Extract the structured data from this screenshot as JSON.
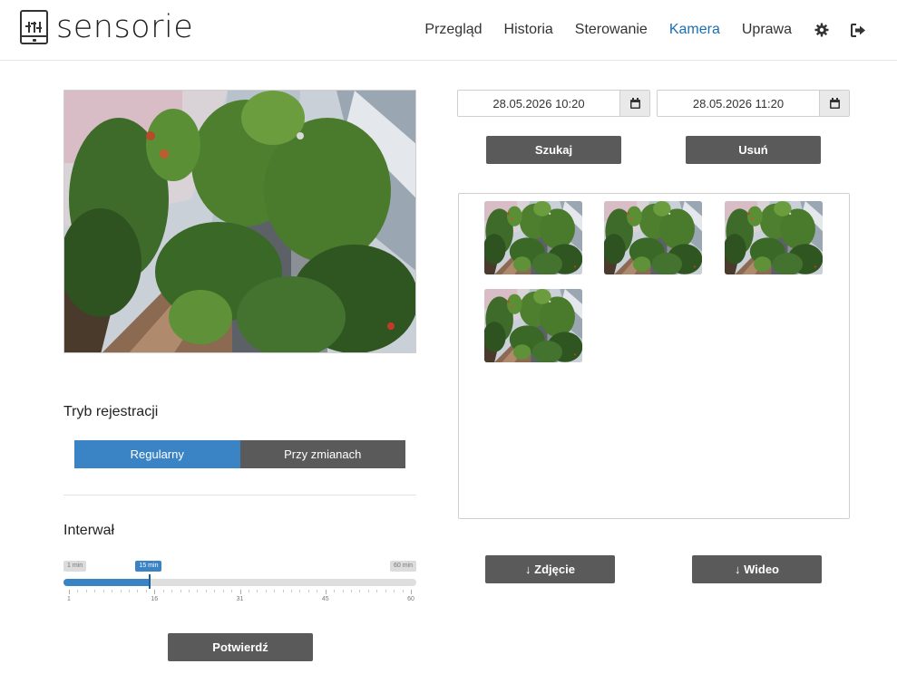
{
  "app": {
    "name": "sensorie"
  },
  "nav": {
    "items": [
      {
        "label": "Przegląd",
        "active": false
      },
      {
        "label": "Historia",
        "active": false
      },
      {
        "label": "Sterowanie",
        "active": false
      },
      {
        "label": "Kamera",
        "active": true
      },
      {
        "label": "Uprawa",
        "active": false
      }
    ],
    "settings_icon": "gear-icon",
    "logout_icon": "sign-out-icon",
    "active_color": "#1a6fb3"
  },
  "recording": {
    "title": "Tryb rejestracji",
    "options": [
      {
        "label": "Regularny",
        "selected": true
      },
      {
        "label": "Przy zmianach",
        "selected": false
      }
    ]
  },
  "interval": {
    "title": "Interwał",
    "min_label": "1 min",
    "max_label": "60 min",
    "current_label": "15 min",
    "min": 1,
    "max": 60,
    "value": 15,
    "tick_labels": [
      "1",
      "16",
      "31",
      "45",
      "60"
    ]
  },
  "confirm_label": "Potwierdź",
  "search": {
    "from": "28.05.2026 10:20",
    "to": "28.05.2026 11:20",
    "calendar_icon": "calendar-icon",
    "search_label": "Szukaj",
    "delete_label": "Usuń"
  },
  "gallery": {
    "thumbnail_count": 4
  },
  "downloads": {
    "photo_label": "↓ Zdjęcie",
    "video_label": "↓ Wideo"
  },
  "colors": {
    "accent": "#3a84c5",
    "button": "#5a5a5a"
  }
}
